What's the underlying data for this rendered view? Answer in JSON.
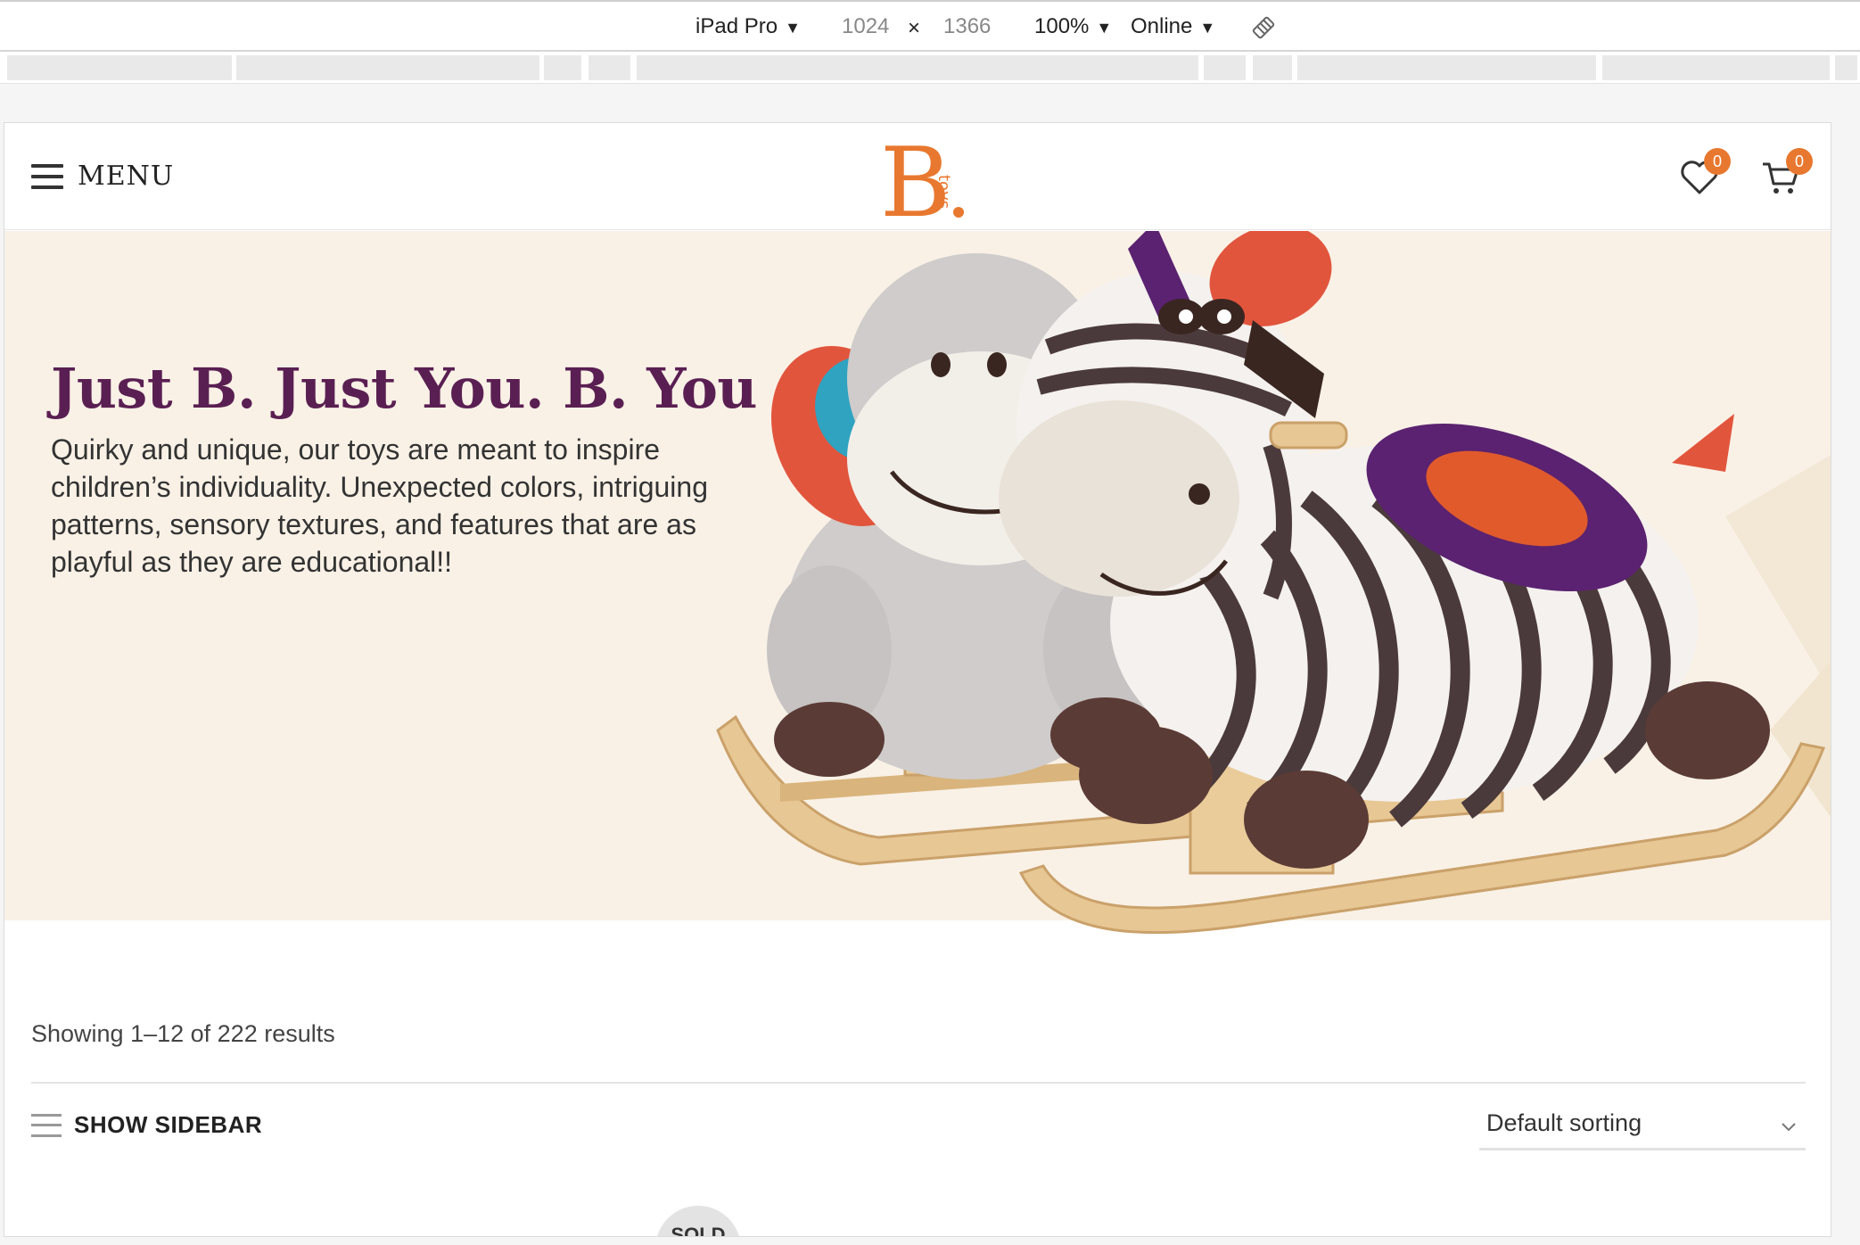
{
  "devtools": {
    "device": "iPad Pro",
    "width": "1024",
    "times": "×",
    "height": "1366",
    "zoom": "100%",
    "network": "Online",
    "caret": "▼"
  },
  "header": {
    "menu_label": "MENU",
    "wishlist_count": "0",
    "cart_count": "0",
    "logo_letter": "B",
    "logo_word": "toys"
  },
  "hero": {
    "title": "Just B. Just You. B. You",
    "text": "Quirky and unique, our toys are meant to inspire children’s individuality. Unexpected colors, intriguing patterns, sensory textures, and features that are as playful as they are educational!!"
  },
  "shop": {
    "results": "Showing 1–12 of 222 results",
    "show_sidebar": "SHOW SIDEBAR",
    "sorting": "Default sorting",
    "sold_label": "SOLD"
  },
  "colors": {
    "accent": "#e8782f",
    "title": "#5a1f52",
    "hero_bg": "#f9f1e6"
  }
}
